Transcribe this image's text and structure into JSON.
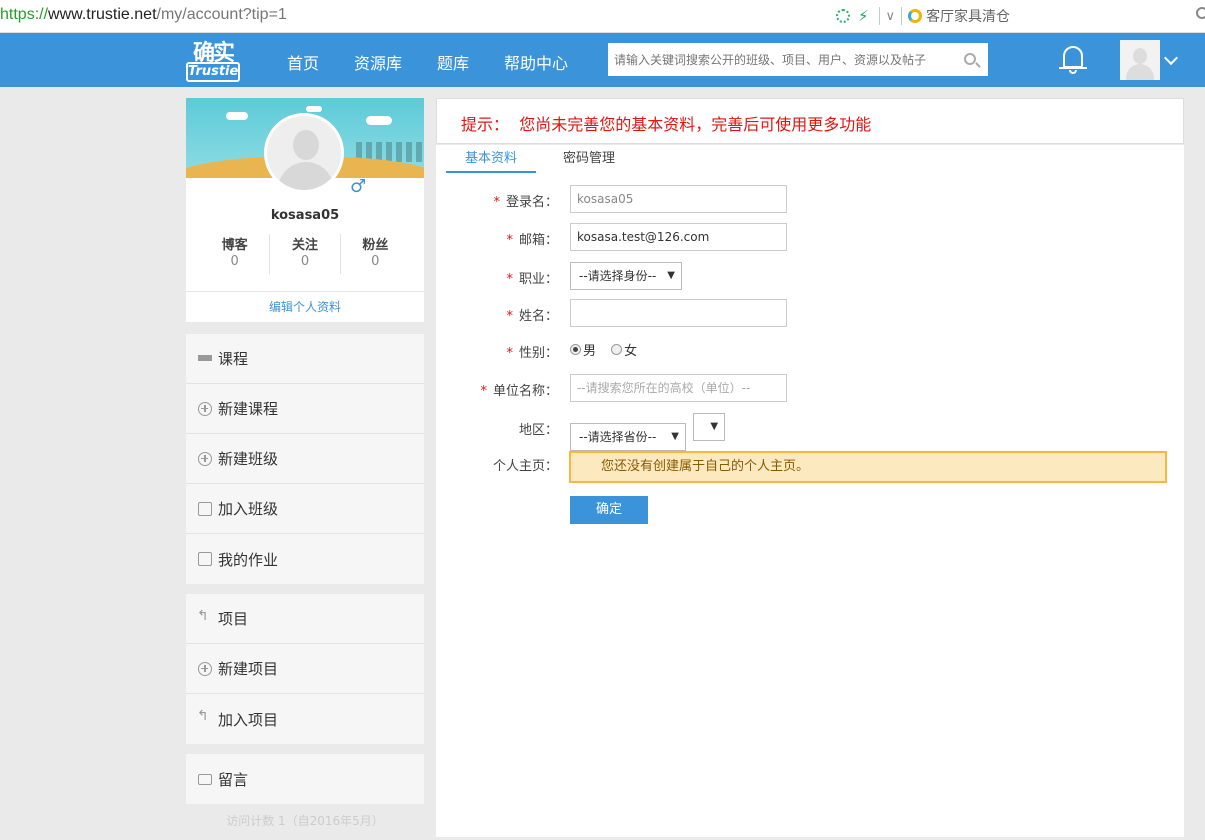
{
  "browser": {
    "url_proto": "https://",
    "url_host": "www.trustie.net",
    "url_path": "/my/account?tip=1",
    "search_hint": "客厅家具清仓"
  },
  "header": {
    "logo_top": "确实",
    "logo_bottom": "Trustie",
    "nav": [
      "首页",
      "资源库",
      "题库",
      "帮助中心"
    ],
    "search_placeholder": "请输入关键词搜索公开的班级、项目、用户、资源以及帖子"
  },
  "profile": {
    "username": "kosasa05",
    "gender_symbol": "♂",
    "stats": [
      {
        "label": "博客",
        "value": "0"
      },
      {
        "label": "关注",
        "value": "0"
      },
      {
        "label": "粉丝",
        "value": "0"
      }
    ],
    "edit_link": "编辑个人资料"
  },
  "menu_course": [
    "课程",
    "新建课程",
    "新建班级",
    "加入班级",
    "我的作业"
  ],
  "menu_project": [
    "项目",
    "新建项目",
    "加入项目"
  ],
  "menu_message": [
    "留言"
  ],
  "visits": "访问计数 1（自2016年5月）",
  "tip": {
    "label": "提示：",
    "text": "您尚未完善您的基本资料，完善后可使用更多功能"
  },
  "tabs": [
    "基本资料",
    "密码管理"
  ],
  "form": {
    "login_label": "登录名：",
    "login_value": "kosasa05",
    "email_label": "邮箱：",
    "email_value": "kosasa.test@126.com",
    "job_label": "职业：",
    "job_value": "--请选择身份--",
    "name_label": "姓名：",
    "name_value": "",
    "gender_label": "性别：",
    "gender_male": "男",
    "gender_female": "女",
    "unit_label": "单位名称：",
    "unit_placeholder": "--请搜索您所在的高校（单位）--",
    "region_label": "地区：",
    "region_value": "--请选择省份--",
    "homepage_label": "个人主页：",
    "homepage_text": "您还没有创建属于自己的个人主页。",
    "submit": "确定"
  },
  "colors": {
    "brand_blue": "#3b94d9",
    "tip_red": "#e0160f",
    "warn_bg": "#fde9bf",
    "warn_border": "#f6b73c"
  }
}
